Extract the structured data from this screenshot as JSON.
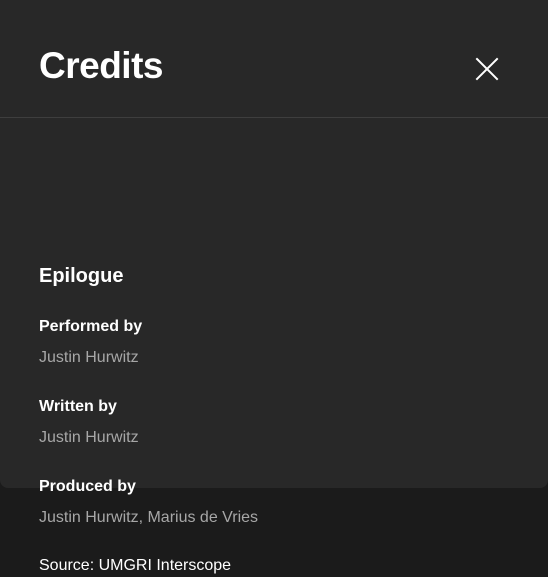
{
  "dialog": {
    "title": "Credits",
    "close_icon": "close-icon"
  },
  "song": {
    "title": "Epilogue"
  },
  "credits": [
    {
      "role": "Performed by",
      "names": "Justin Hurwitz"
    },
    {
      "role": "Written by",
      "names": "Justin Hurwitz"
    },
    {
      "role": "Produced by",
      "names": "Justin Hurwitz, Marius de Vries"
    }
  ],
  "source": "Source: UMGRI Interscope",
  "colors": {
    "background": "#282828",
    "text_primary": "#ffffff",
    "text_secondary": "#a7a7a7",
    "divider": "#3e3e3e"
  }
}
